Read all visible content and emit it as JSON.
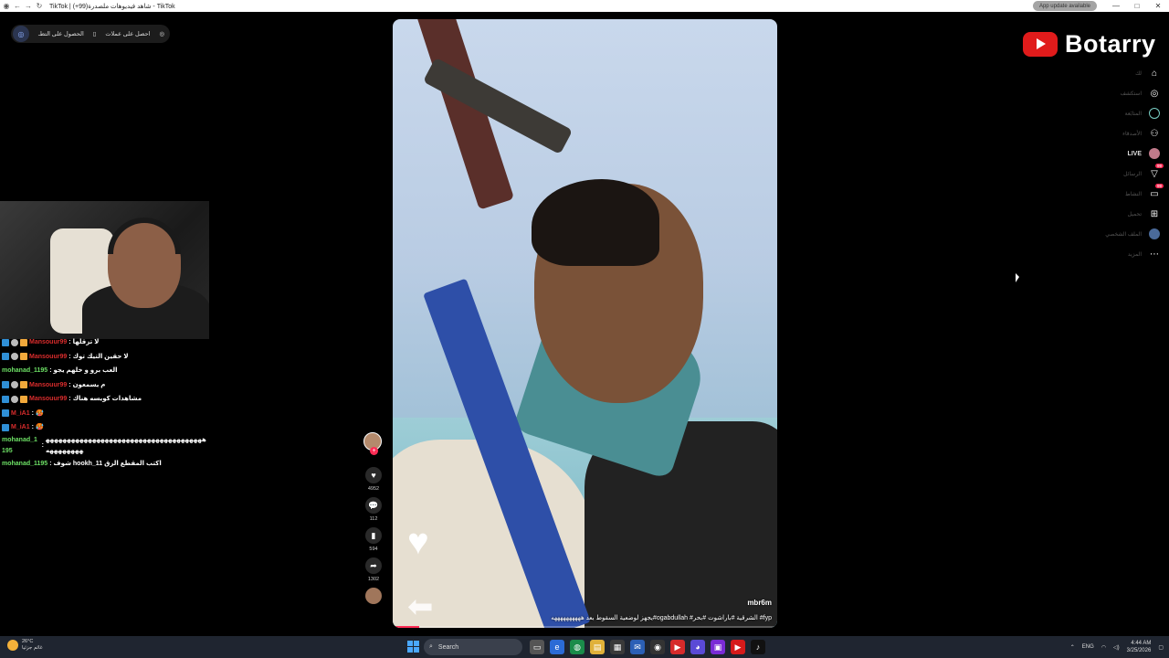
{
  "window": {
    "title": "TikTok | شاهد فيديوهات ملصدرة(99+) - TikTok",
    "update_label": "App update available"
  },
  "getapp": {
    "label1": "احصل على عملات",
    "label2": "الحصول على التطـ"
  },
  "brand": {
    "name": "Botarry",
    "youtube_color": "#e01b1b"
  },
  "sidebar": {
    "items": [
      {
        "label": "لك",
        "icon": "home-icon"
      },
      {
        "label": "استكشف",
        "icon": "compass-icon"
      },
      {
        "label": "المتابَعة",
        "icon": "following-icon"
      },
      {
        "label": "الأصدقاء",
        "icon": "friends-icon"
      },
      {
        "label": "LIVE",
        "icon": "live-icon"
      },
      {
        "label": "الرسائل",
        "icon": "messages-icon",
        "badge": "99"
      },
      {
        "label": "النشاط",
        "icon": "activity-icon",
        "badge": "99"
      },
      {
        "label": "تحميل",
        "icon": "upload-icon"
      },
      {
        "label": "الملف الشخصي",
        "icon": "profile-icon"
      },
      {
        "label": "المزيد",
        "icon": "more-icon"
      }
    ]
  },
  "video": {
    "author": "mbr6m",
    "caption": "يجهز لوضعية السقوط بعد ههههههههههه#ogabdullah #الشرقية #باراشوت #بحر #fyp",
    "progress_fraction": 0.07
  },
  "actions": {
    "likes": "4952",
    "comments": "112",
    "saves": "594",
    "shares": "1302"
  },
  "chat": [
    {
      "user": "Mansouur99",
      "user_color": "red",
      "badges": 3,
      "msg": "لا تزقلها"
    },
    {
      "user": "Mansouur99",
      "user_color": "red",
      "badges": 3,
      "msg": "لا حقين التيك توك"
    },
    {
      "user": "mohanad_1195",
      "user_color": "green",
      "badges": 0,
      "msg": "العب برو و خلهم يجو"
    },
    {
      "user": "Mansouur99",
      "user_color": "red",
      "badges": 3,
      "msg": "م يسمعون"
    },
    {
      "user": "Mansouur99",
      "user_color": "red",
      "badges": 3,
      "msg": "مشاهدات كويسه هناك"
    },
    {
      "user": "M_iA1",
      "user_color": "red",
      "badges": 1,
      "msg": "🥵"
    },
    {
      "user": "M_iA1",
      "user_color": "red",
      "badges": 1,
      "msg": "🥵"
    },
    {
      "user": "mohanad_1195",
      "user_color": "green",
      "badges": 0,
      "msg": "ههههههههههههههههههههههههههههههههههههههههههههههه"
    },
    {
      "user": "mohanad_1195",
      "user_color": "green",
      "badges": 0,
      "msg": "شوف hookh_11 اكتب المقطع الزق"
    }
  ],
  "taskbar": {
    "temperature": "26°C",
    "weather_text": "غائم جزئيا",
    "search_placeholder": "Search",
    "language": "ENG",
    "time": "4:44 AM",
    "date": "3/25/2026"
  }
}
